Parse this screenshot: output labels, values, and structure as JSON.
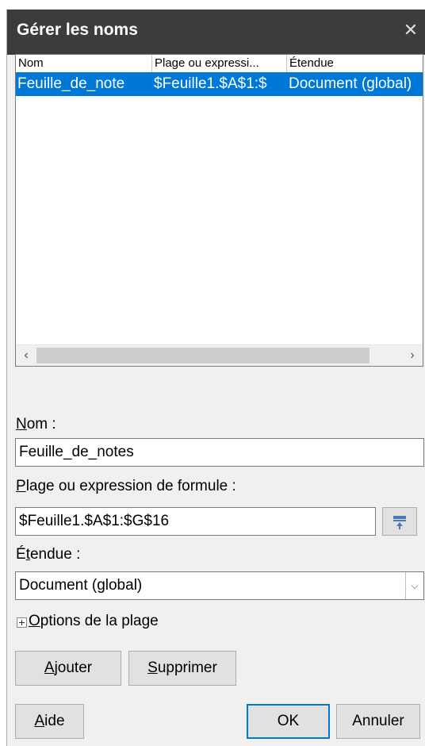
{
  "title": "Gérer les noms",
  "columns": [
    "Nom",
    "Plage ou expressi...",
    "Étendue"
  ],
  "rows": [
    {
      "name": "Feuille_de_note",
      "range": "$Feuille1.$A$1:$",
      "scope": "Document (global)"
    }
  ],
  "labels": {
    "name": {
      "accel": "N",
      "rest": "om :"
    },
    "range": {
      "accel": "P",
      "rest": "lage ou expression de formule :"
    },
    "scope": {
      "pre": "É",
      "accel": "t",
      "rest": "endue :"
    },
    "options": {
      "accel": "O",
      "rest": "ptions de la plage"
    }
  },
  "fields": {
    "name_value": "Feuille_de_notes",
    "range_value": "$Feuille1.$A$1:$G$16",
    "scope_value": "Document (global)"
  },
  "buttons": {
    "add": {
      "accel": "A",
      "rest": "jouter"
    },
    "delete": {
      "accel": "S",
      "rest": "upprimer"
    },
    "help": {
      "accel": "A",
      "rest": "ide"
    },
    "ok": "OK",
    "cancel": "Annuler"
  },
  "colors": {
    "titlebar": "#3c3c3c",
    "selection": "#0078d7"
  },
  "icons": {
    "close": "close-icon",
    "shrink": "shrink-icon",
    "dropdown": "chevron-down-icon",
    "expand": "plus-box-icon"
  }
}
